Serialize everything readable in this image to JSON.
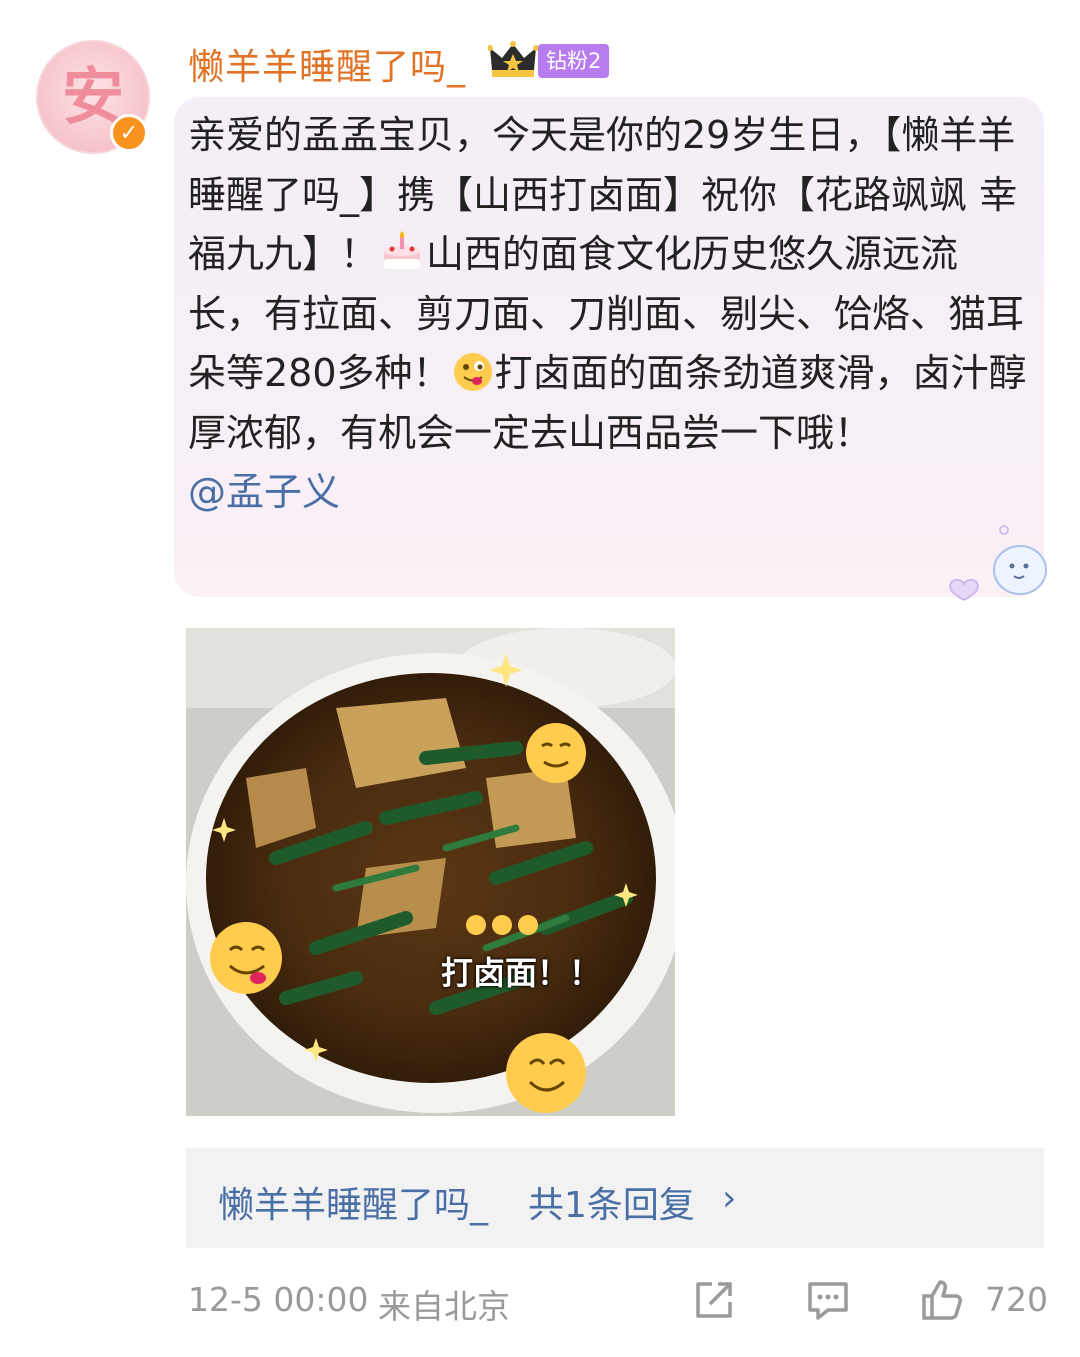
{
  "avatar": {
    "char": "安"
  },
  "header": {
    "username": "懒羊羊睡醒了吗_",
    "fan_badge": "钻粉2"
  },
  "post": {
    "text_before_cake": "亲爱的孟孟宝贝，今天是你的29岁生日，【懒羊羊睡醒了吗_】携【山西打卤面】祝你【花路飒飒 幸福九九】！",
    "text_before_face": "山西的面食文化历史悠久源远流长，有拉面、剪刀面、刀削面、剔尖、饸烙、猫耳朵等280多种！",
    "text_after_face": "打卤面的面条劲道爽滑，卤汁醇厚浓郁，有机会一定去山西品尝一下哦！",
    "mention": "@孟子义"
  },
  "image": {
    "caption": "打卤面！！"
  },
  "reply": {
    "user": "懒羊羊睡醒了吗_",
    "count_text": "共1条回复",
    "chevron": "›"
  },
  "footer": {
    "time": "12-5 00:00",
    "location": "来自北京",
    "like_count": "720"
  },
  "icons": [
    "verified-icon",
    "crown-icon",
    "cake-emoji",
    "tongue-face-emoji",
    "share-icon",
    "comment-icon",
    "like-icon"
  ],
  "colors": {
    "username": "#e07325",
    "link": "#4a6fa5",
    "badge": "#b87cf0",
    "verified": "#f7931e"
  }
}
